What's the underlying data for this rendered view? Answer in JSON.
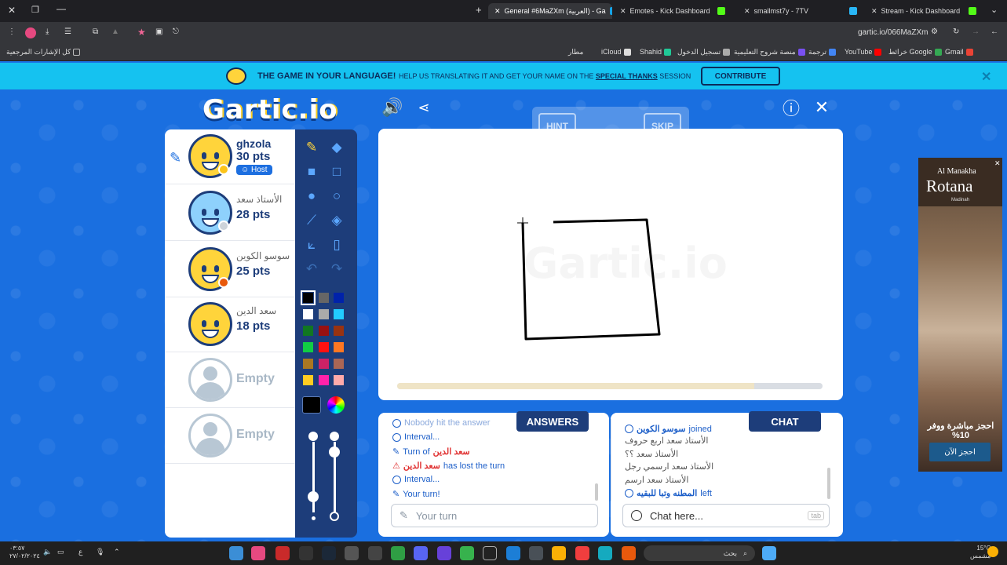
{
  "browser": {
    "tabs": [
      {
        "label": "General #6MaZXm (العربية) - Ga",
        "active": true
      },
      {
        "label": "Emotes - Kick Dashboard",
        "active": false
      },
      {
        "label": "smallmst7y - 7TV",
        "active": false
      },
      {
        "label": "Stream - Kick Dashboard",
        "active": false
      }
    ],
    "url": "gartic.io/066MaZXm",
    "bookmarks_label": "كل الإشارات المرجعية",
    "bookmarks": [
      "Gmail",
      "خرائط Google",
      "YouTube",
      "ترجمة",
      "منصة شروح التعليمية",
      "تسجيل الدخول",
      "Shahid",
      "iCloud",
      "مطار"
    ]
  },
  "banner": {
    "headline": "THE GAME IN YOUR LANGUAGE!",
    "text": "HELP US TRANSLATING IT AND GET YOUR NAME ON THE",
    "link": "SPECIAL THANKS",
    "text2": "SESSION",
    "button": "CONTRIBUTE"
  },
  "logo": "Gartic.io",
  "hint_bar": {
    "hint": "HINT",
    "skip": "SKIP"
  },
  "players": [
    {
      "name": "ghzola",
      "points": "30 pts",
      "badge": "Host",
      "status_color": "#fcc419",
      "drawing": true
    },
    {
      "name": "الأستاذ سعد",
      "points": "28 pts",
      "status_color": "#ced4da"
    },
    {
      "name": "سوسو الكوين",
      "points": "25 pts",
      "status_color": "#e8590c"
    },
    {
      "name": "سعد الدين",
      "points": "18 pts",
      "status_color": null
    },
    {
      "name": "Empty",
      "points": ""
    },
    {
      "name": "Empty",
      "points": ""
    }
  ],
  "palette": {
    "colors": [
      "#000000",
      "#666666",
      "#0022aa",
      "#ffffff",
      "#aaaaaa",
      "#22ccff",
      "#117722",
      "#991111",
      "#993311",
      "#11cc44",
      "#ff1111",
      "#ff7722",
      "#aa7722",
      "#cc2266",
      "#aa6655",
      "#ffcc22",
      "#ff22aa",
      "#ffaaaa"
    ],
    "selected": "#000000",
    "current": "#000000"
  },
  "answers": {
    "title": "ANSWERS",
    "messages": [
      {
        "icon": "clock",
        "text": "Nobody hit the answer"
      },
      {
        "icon": "clock",
        "text": "Interval..."
      },
      {
        "icon": "pencil",
        "text": "Turn of",
        "name": "سعد الدين"
      },
      {
        "icon": "warning",
        "name": "سعد الدين",
        "text": "has lost the turn"
      },
      {
        "icon": "clock",
        "text": "Interval..."
      },
      {
        "icon": "pencil",
        "text": "Your turn!"
      }
    ],
    "input_placeholder": "Your turn"
  },
  "chat": {
    "title": "CHAT",
    "messages": [
      {
        "icon": "info",
        "name": "سوسو الكوين",
        "text": "joined"
      },
      {
        "text": "الأستاذ سعد اربع حروف"
      },
      {
        "text": "الأستاذ سعد ؟؟"
      },
      {
        "text": "الأستاذ سعد ارسمي رجل"
      },
      {
        "text": "الأستاذ سعد ارسم"
      },
      {
        "icon": "info",
        "name": "المطنه وتبا للبقيه",
        "text": "left"
      }
    ],
    "input_placeholder": "Chat here...",
    "tab_hint": "tab"
  },
  "ad": {
    "brand_top": "Al Manakha",
    "brand": "Rotana",
    "sub": "Madinah",
    "offer": "احجز مباشرة ووفر 10%",
    "cta": "احجز الآن"
  },
  "taskbar": {
    "search_placeholder": "بحث",
    "weather": "15°C",
    "weather_text": "مشمس",
    "time": "٠٣:٥٧",
    "date": "٢٧/٠٢/٢٠٢٤"
  },
  "round_progress": 0.84
}
